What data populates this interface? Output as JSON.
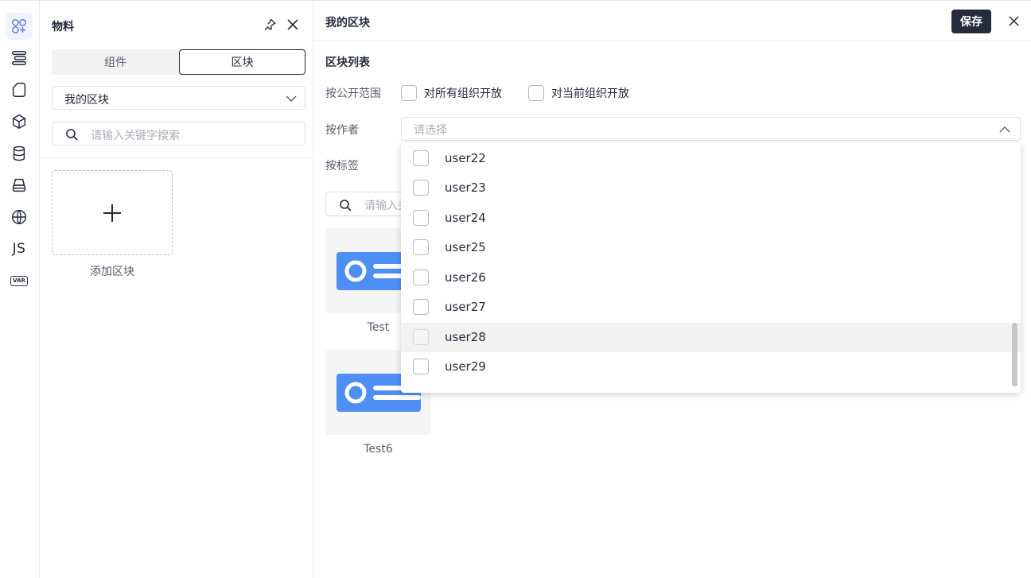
{
  "rail": {
    "icons": [
      "components-icon",
      "outline-icon",
      "page-icon",
      "block-icon",
      "datasource-icon",
      "bridge-icon",
      "i18n-icon",
      "js-icon",
      "variable-icon"
    ],
    "js_label": "JS",
    "var_label": "VAR"
  },
  "panel": {
    "title": "物料",
    "tabs": [
      "组件",
      "区块"
    ],
    "active_tab": "区块",
    "group_select": "我的区块",
    "search_placeholder": "请输入关键字搜索",
    "add_block_label": "添加区块"
  },
  "main": {
    "title": "我的区块",
    "save_label": "保存",
    "section_title": "区块列表",
    "filter_scope_label": "按公开范围",
    "scope_options": [
      "对所有组织开放",
      "对当前组织开放"
    ],
    "filter_author_label": "按作者",
    "author_placeholder": "请选择",
    "filter_tag_label": "按标签",
    "block_search_placeholder": "请输入关键字搜索",
    "blocks": [
      "Test",
      "Test6"
    ]
  },
  "dropdown": {
    "items": [
      "user22",
      "user23",
      "user24",
      "user25",
      "user26",
      "user27",
      "user28",
      "user29"
    ],
    "hovered": "user28"
  },
  "colors": {
    "text": "#252b3a",
    "accent": "#5e7ce0",
    "card_blue": "#4d8ff5",
    "save_bg": "#252b3a"
  }
}
